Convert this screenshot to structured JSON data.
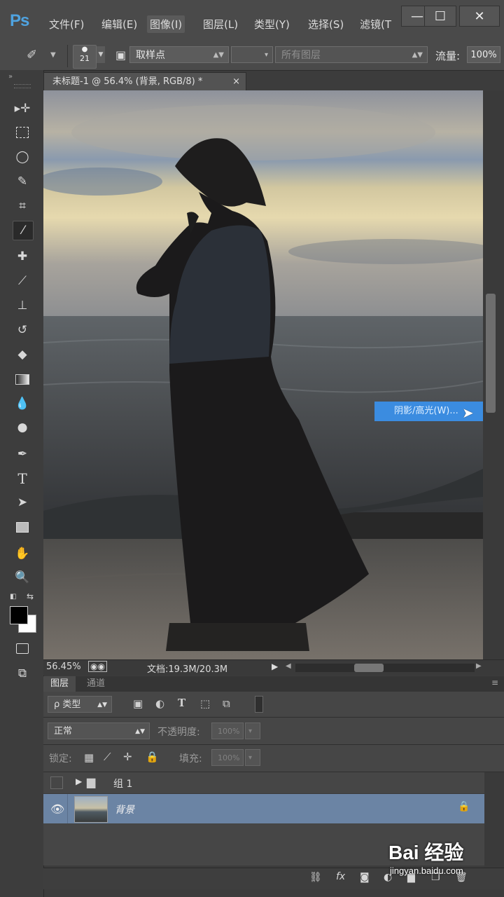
{
  "app": {
    "logo": "Ps"
  },
  "menu": [
    {
      "label": "文件(F)"
    },
    {
      "label": "编辑(E)"
    },
    {
      "label": "图像(I)"
    },
    {
      "label": "图层(L)"
    },
    {
      "label": "类型(Y)"
    },
    {
      "label": "选择(S)"
    },
    {
      "label": "滤镜(T"
    }
  ],
  "window_controls": {
    "minimize": "—",
    "maximize": "☐",
    "close": "✕"
  },
  "options": {
    "brush_size": "21",
    "sample_mode": "取样点",
    "sample_layers": "所有图层",
    "flow_label": "流量:",
    "flow_value": "100%"
  },
  "document": {
    "tab_title": "未标题-1 @ 56.4% (背景, RGB/8) *",
    "tab_close": "×",
    "tooltip": "阴影/高光(W)...",
    "zoom": "56.45%",
    "doc_size": "文档:19.3M/20.3M"
  },
  "layers_panel": {
    "tabs": [
      "图层",
      "通道"
    ],
    "filter_label": "ρ 类型",
    "blend_mode": "正常",
    "opacity_label": "不透明度:",
    "opacity_value": "100%",
    "lock_label": "锁定:",
    "fill_label": "填充:",
    "fill_value": "100%",
    "layers": [
      {
        "name": "组 1",
        "type": "group",
        "visible": false
      },
      {
        "name": "背景",
        "type": "layer",
        "visible": true,
        "locked": true
      }
    ]
  },
  "watermark": {
    "brand": "Bai  经验",
    "url": "jingyan.baidu.com"
  },
  "colors": {
    "accent": "#3b8ce0",
    "selected_layer": "#6b84a4",
    "panel": "#464646"
  }
}
